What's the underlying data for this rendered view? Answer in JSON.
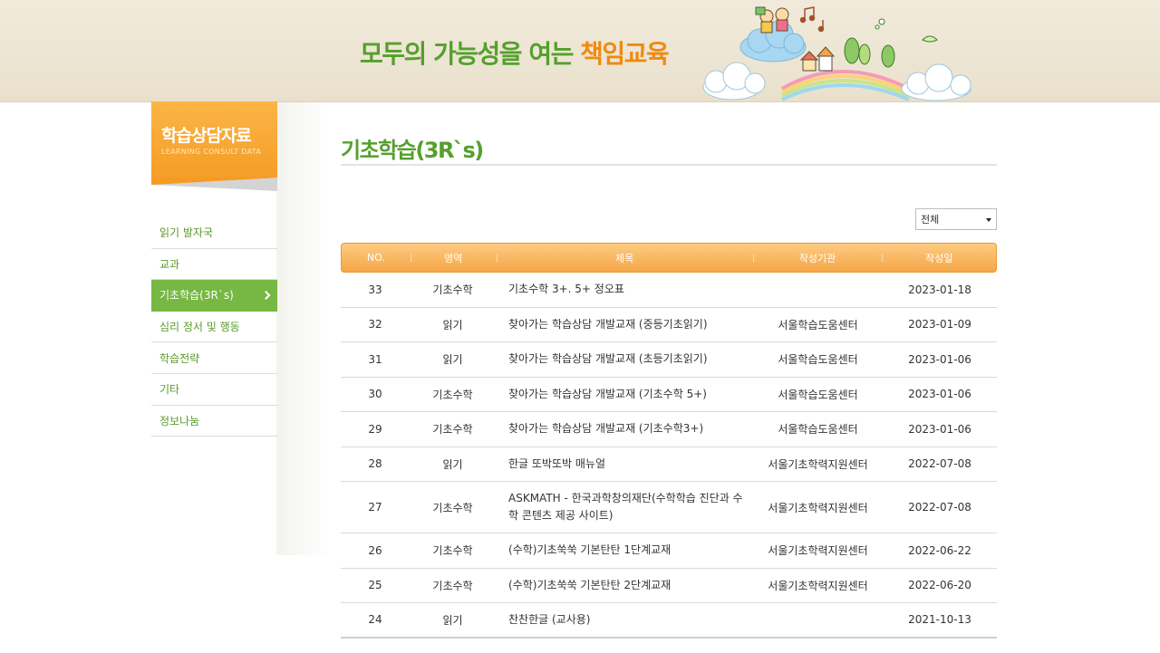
{
  "banner": {
    "slogan_main": "모두의 가능성을 여는 ",
    "slogan_highlight": "책임교육"
  },
  "sidebar": {
    "title": "학습상담자료",
    "subtitle": "LEARNING CONSULT DATA",
    "items": [
      {
        "label": "읽기 발자국",
        "active": false
      },
      {
        "label": "교과",
        "active": false
      },
      {
        "label": "기초학습(3R`s)",
        "active": true
      },
      {
        "label": "심리 정서 및 행동",
        "active": false
      },
      {
        "label": "학습전략",
        "active": false
      },
      {
        "label": "기타",
        "active": false
      },
      {
        "label": "정보나눔",
        "active": false
      }
    ]
  },
  "main": {
    "title": "기초학습(3R`s)",
    "filter": {
      "selected": "전체"
    },
    "columns": {
      "no": "NO.",
      "area": "영역",
      "title": "제목",
      "org": "작성기관",
      "date": "작성일"
    },
    "rows": [
      {
        "no": "33",
        "area": "기초수학",
        "title": "기초수학 3+. 5+ 정오표",
        "org": "",
        "date": "2023-01-18"
      },
      {
        "no": "32",
        "area": "읽기",
        "title": "찾아가는 학습상담 개발교재 (중등기초읽기)",
        "org": "서울학습도움센터",
        "date": "2023-01-09"
      },
      {
        "no": "31",
        "area": "읽기",
        "title": "찾아가는 학습상담 개발교재 (초등기초읽기)",
        "org": "서울학습도움센터",
        "date": "2023-01-06"
      },
      {
        "no": "30",
        "area": "기초수학",
        "title": "찾아가는 학습상담 개발교재 (기초수학 5+)",
        "org": "서울학습도움센터",
        "date": "2023-01-06"
      },
      {
        "no": "29",
        "area": "기초수학",
        "title": "찾아가는 학습상담 개발교재 (기초수학3+)",
        "org": "서울학습도움센터",
        "date": "2023-01-06"
      },
      {
        "no": "28",
        "area": "읽기",
        "title": "한글 또박또박 매뉴얼",
        "org": "서울기초학력지원센터",
        "date": "2022-07-08"
      },
      {
        "no": "27",
        "area": "기초수학",
        "title": "ASKMATH - 한국과학창의재단(수학학습 진단과 수학 콘텐츠 제공 사이트)",
        "org": "서울기초학력지원센터",
        "date": "2022-07-08"
      },
      {
        "no": "26",
        "area": "기초수학",
        "title": "(수학)기초쑥쑥 기본탄탄 1단계교재",
        "org": "서울기초학력지원센터",
        "date": "2022-06-22"
      },
      {
        "no": "25",
        "area": "기초수학",
        "title": "(수학)기초쑥쑥 기본탄탄 2단계교재",
        "org": "서울기초학력지원센터",
        "date": "2022-06-20"
      },
      {
        "no": "24",
        "area": "읽기",
        "title": "찬찬한글 (교사용)",
        "org": "",
        "date": "2021-10-13"
      }
    ]
  }
}
